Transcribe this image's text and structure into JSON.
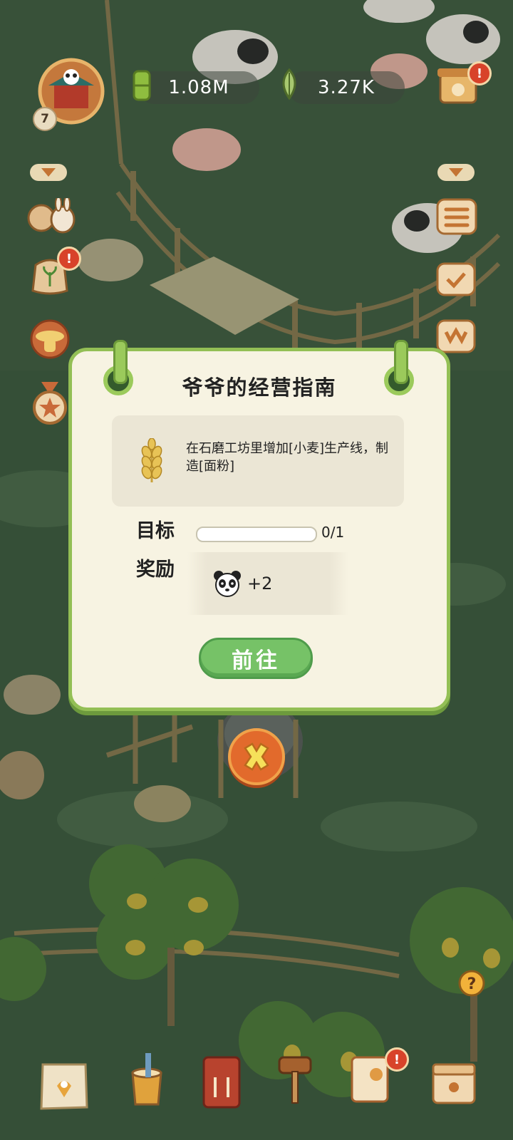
{
  "resources": {
    "bamboo_amount": "1.08M",
    "leaf_amount": "3.27K"
  },
  "player": {
    "level": "7"
  },
  "dialog": {
    "title": "爷爷的经营指南",
    "task_description": "在石磨工坊里增加[小麦]生产线，制造[面粉]",
    "target_label": "目标",
    "progress_text": "0/1",
    "progress_fraction": 0,
    "reward_label": "奖励",
    "reward_amount": "+2",
    "go_button_label": "前往"
  },
  "colors": {
    "accent_green": "#93bf55",
    "button_green": "#76c267",
    "close_orange": "#e26a2c",
    "alert_red": "#d8432a"
  },
  "icons": {
    "task_icon": "wheat-icon",
    "reward_icon": "panda-icon",
    "close_icon": "close-x-icon"
  }
}
